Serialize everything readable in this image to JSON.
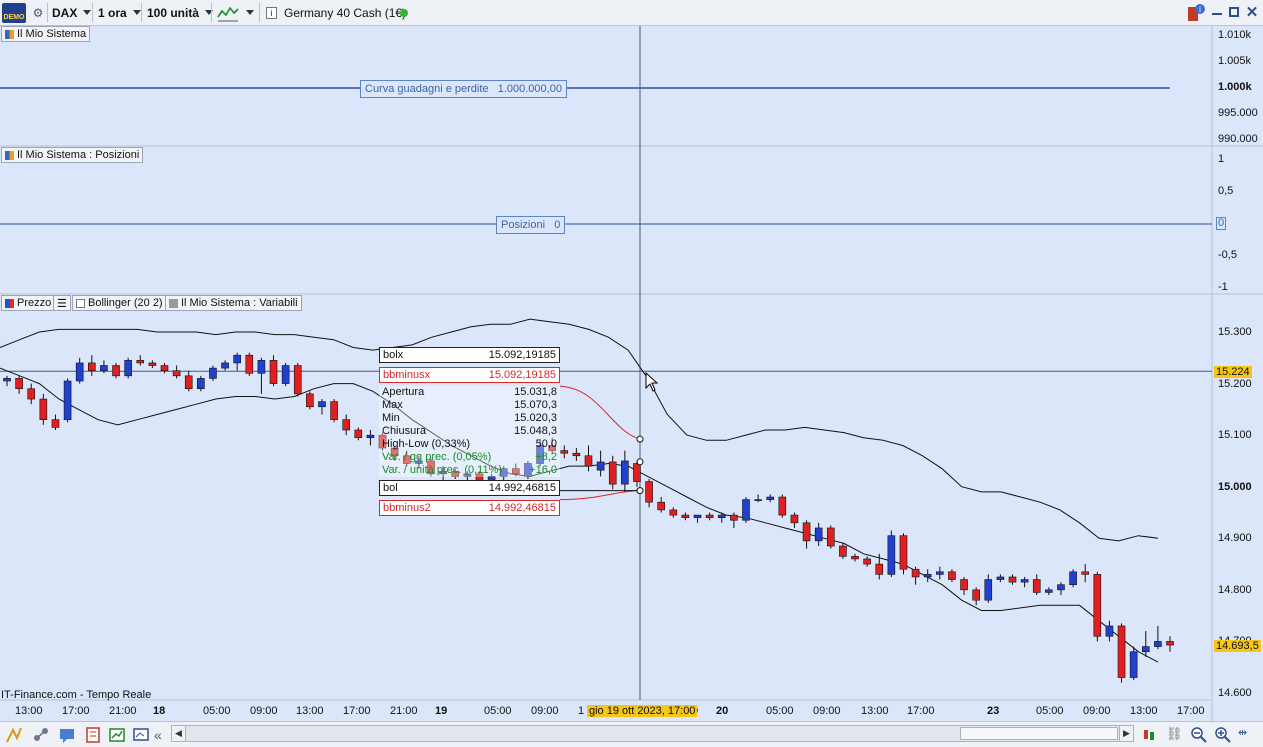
{
  "toolbar": {
    "badge": "DEMO",
    "symbol": "DAX",
    "timeframe": "1 ora",
    "units": "100 unità",
    "instrument": "Germany 40 Cash (1€)",
    "info": "i"
  },
  "panels": {
    "equity": {
      "label": "Il Mio Sistema",
      "line_label": "Curva guadagni e perdite",
      "line_value": "1.000.000,00",
      "axis": [
        "1.010k",
        "1.005k",
        "1.000k",
        "995.000",
        "990.000"
      ]
    },
    "positions": {
      "label": "Il Mio Sistema : Posizioni",
      "line_label": "Posizioni",
      "line_value": "0",
      "axis": [
        "1",
        "0,5",
        "0",
        "-0,5",
        "-1"
      ]
    },
    "price": {
      "labels": [
        "Prezzo",
        "Bollinger (20 2)",
        "Il Mio Sistema : Variabili"
      ],
      "axis": [
        "15.300",
        "15.200",
        "15.100",
        "15.000",
        "14.900",
        "14.800",
        "14.700",
        "14.600"
      ],
      "current_price": "15.224",
      "last_price": "14.693,5",
      "source": "IT-Finance.com - Tempo Reale"
    }
  },
  "tooltip": {
    "bolx_label": "bolx",
    "bolx_value": "15.092,19185",
    "bbminusx_label": "bbminusx",
    "bbminusx_value": "15.092,19185",
    "rows": [
      {
        "k": "Apertura",
        "v": "15.031,8"
      },
      {
        "k": "Max",
        "v": "15.070,3"
      },
      {
        "k": "Min",
        "v": "15.020,3"
      },
      {
        "k": "Chiusura",
        "v": "15.048,3"
      },
      {
        "k": "High-Low (0,33%)",
        "v": "50,0"
      },
      {
        "k": "Var. / gg prec. (0,05%)",
        "v": "+8,2"
      },
      {
        "k": "Var. / unità prec. (0,11%)",
        "v": "+16,0"
      }
    ],
    "bol_label": "bol",
    "bol_value": "14.992,46815",
    "bbminus2_label": "bbminus2",
    "bbminus2_value": "14.992,46815"
  },
  "time_axis": [
    "13:00",
    "17:00",
    "21:00",
    "18",
    "05:00",
    "09:00",
    "13:00",
    "17:00",
    "21:00",
    "19",
    "05:00",
    "09:00",
    "1",
    "0",
    "20",
    "05:00",
    "09:00",
    "13:00",
    "17:00",
    "23",
    "05:00",
    "09:00",
    "13:00",
    "17:00"
  ],
  "crosshair_date": "gio 19 ott 2023, 17:00",
  "chart_data": {
    "type": "candlestick",
    "ohlc": [
      [
        15205,
        15215,
        15195,
        15210
      ],
      [
        15210,
        15215,
        15180,
        15190
      ],
      [
        15190,
        15200,
        15160,
        15170
      ],
      [
        15170,
        15180,
        15120,
        15130
      ],
      [
        15130,
        15140,
        15110,
        15115
      ],
      [
        15130,
        15210,
        15125,
        15205
      ],
      [
        15205,
        15250,
        15200,
        15240
      ],
      [
        15240,
        15255,
        15215,
        15225
      ],
      [
        15225,
        15245,
        15220,
        15235
      ],
      [
        15235,
        15240,
        15210,
        15215
      ],
      [
        15215,
        15250,
        15210,
        15245
      ],
      [
        15245,
        15255,
        15235,
        15240
      ],
      [
        15240,
        15245,
        15230,
        15235
      ],
      [
        15235,
        15240,
        15220,
        15225
      ],
      [
        15225,
        15235,
        15210,
        15215
      ],
      [
        15215,
        15225,
        15185,
        15190
      ],
      [
        15190,
        15215,
        15185,
        15210
      ],
      [
        15210,
        15235,
        15205,
        15230
      ],
      [
        15230,
        15245,
        15225,
        15240
      ],
      [
        15240,
        15260,
        15225,
        15255
      ],
      [
        15255,
        15260,
        15215,
        15220
      ],
      [
        15220,
        15250,
        15180,
        15245
      ],
      [
        15245,
        15255,
        15195,
        15200
      ],
      [
        15200,
        15240,
        15195,
        15235
      ],
      [
        15235,
        15240,
        15175,
        15180
      ],
      [
        15180,
        15185,
        15150,
        15155
      ],
      [
        15155,
        15170,
        15140,
        15165
      ],
      [
        15165,
        15170,
        15125,
        15130
      ],
      [
        15130,
        15140,
        15100,
        15110
      ],
      [
        15110,
        15115,
        15090,
        15095
      ],
      [
        15095,
        15110,
        15080,
        15100
      ],
      [
        15100,
        15105,
        15070,
        15075
      ],
      [
        15075,
        15080,
        15050,
        15060
      ],
      [
        15060,
        15070,
        15040,
        15045
      ],
      [
        15045,
        15060,
        15035,
        15050
      ],
      [
        15050,
        15055,
        15020,
        15025
      ],
      [
        15025,
        15040,
        15010,
        15030
      ],
      [
        15030,
        15035,
        15015,
        15020
      ],
      [
        15020,
        15030,
        15010,
        15025
      ],
      [
        15025,
        15030,
        15000,
        15005
      ],
      [
        15005,
        15025,
        15000,
        15020
      ],
      [
        15020,
        15040,
        15010,
        15035
      ],
      [
        15035,
        15045,
        15020,
        15025
      ],
      [
        15020,
        15050,
        15015,
        15045
      ],
      [
        15045,
        15090,
        15040,
        15080
      ],
      [
        15080,
        15095,
        15065,
        15070
      ],
      [
        15070,
        15080,
        15055,
        15065
      ],
      [
        15065,
        15075,
        15050,
        15060
      ],
      [
        15060,
        15080,
        15030,
        15040
      ],
      [
        15032,
        15070,
        15020,
        15048
      ],
      [
        15048,
        15060,
        14995,
        15005
      ],
      [
        15005,
        15070,
        14990,
        15050
      ],
      [
        15045,
        15050,
        15000,
        15010
      ],
      [
        15010,
        15015,
        14960,
        14970
      ],
      [
        14970,
        14980,
        14950,
        14955
      ],
      [
        14955,
        14960,
        14940,
        14945
      ],
      [
        14945,
        14950,
        14935,
        14940
      ],
      [
        14940,
        14945,
        14930,
        14945
      ],
      [
        14945,
        14950,
        14935,
        14940
      ],
      [
        14940,
        14950,
        14930,
        14945
      ],
      [
        14945,
        14950,
        14920,
        14935
      ],
      [
        14935,
        14980,
        14930,
        14975
      ],
      [
        14975,
        14985,
        14970,
        14975
      ],
      [
        14975,
        14985,
        14970,
        14980
      ],
      [
        14980,
        14985,
        14940,
        14945
      ],
      [
        14945,
        14950,
        14920,
        14930
      ],
      [
        14930,
        14935,
        14880,
        14895
      ],
      [
        14895,
        14930,
        14885,
        14920
      ],
      [
        14920,
        14925,
        14880,
        14885
      ],
      [
        14885,
        14890,
        14860,
        14865
      ],
      [
        14865,
        14870,
        14855,
        14860
      ],
      [
        14860,
        14865,
        14845,
        14850
      ],
      [
        14850,
        14870,
        14820,
        14830
      ],
      [
        14830,
        14915,
        14825,
        14905
      ],
      [
        14905,
        14910,
        14830,
        14840
      ],
      [
        14840,
        14845,
        14810,
        14825
      ],
      [
        14825,
        14840,
        14815,
        14830
      ],
      [
        14830,
        14845,
        14820,
        14835
      ],
      [
        14835,
        14840,
        14815,
        14820
      ],
      [
        14820,
        14825,
        14790,
        14800
      ],
      [
        14800,
        14805,
        14770,
        14780
      ],
      [
        14780,
        14830,
        14775,
        14820
      ],
      [
        14820,
        14830,
        14815,
        14825
      ],
      [
        14825,
        14830,
        14810,
        14815
      ],
      [
        14815,
        14825,
        14805,
        14820
      ],
      [
        14820,
        14830,
        14790,
        14795
      ],
      [
        14795,
        14805,
        14790,
        14800
      ],
      [
        14800,
        14815,
        14790,
        14810
      ],
      [
        14810,
        14840,
        14805,
        14835
      ],
      [
        14835,
        14850,
        14815,
        14830
      ],
      [
        14830,
        14835,
        14700,
        14710
      ],
      [
        14710,
        14740,
        14700,
        14730
      ],
      [
        14730,
        14735,
        14620,
        14630
      ],
      [
        14630,
        14690,
        14625,
        14680
      ],
      [
        14680,
        14720,
        14670,
        14690
      ],
      [
        14690,
        14730,
        14685,
        14700
      ],
      [
        14700,
        14710,
        14680,
        14693
      ]
    ],
    "upper_band": [
      15270,
      15285,
      15300,
      15305,
      15305,
      15305,
      15305,
      15305,
      15300,
      15300,
      15300,
      15295,
      15300,
      15300,
      15295,
      15295,
      15290,
      15285,
      15270,
      15265,
      15270,
      15275,
      15290,
      15300,
      15310,
      15315,
      15315,
      15325,
      15320,
      15315,
      15305,
      15290,
      15265,
      15210,
      15140,
      15100,
      15090,
      15090,
      15100,
      15110,
      15110,
      15115,
      15110,
      15105,
      15095,
      15090,
      15080,
      15060,
      15035,
      15000,
      14990,
      14990,
      14980,
      14970,
      14955,
      14930,
      14900,
      14895,
      14905,
      14900
    ],
    "lower_band": [
      15230,
      15215,
      15200,
      15170,
      15150,
      15130,
      15120,
      15130,
      15140,
      15150,
      15160,
      15170,
      15175,
      15175,
      15170,
      15175,
      15190,
      15200,
      15200,
      15185,
      15160,
      15130,
      15105,
      15080,
      15060,
      15040,
      15025,
      15020,
      15030,
      15040,
      15040,
      15045,
      15040,
      15020,
      15000,
      14980,
      14960,
      14945,
      14940,
      14930,
      14920,
      14910,
      14900,
      14890,
      14870,
      14860,
      14850,
      14830,
      14810,
      14780,
      14760,
      14760,
      14765,
      14770,
      14770,
      14770,
      14740,
      14710,
      14680,
      14660
    ],
    "bolx": 15092.19185,
    "bol": 14992.46815,
    "equity": 1000000,
    "positions": 0
  }
}
